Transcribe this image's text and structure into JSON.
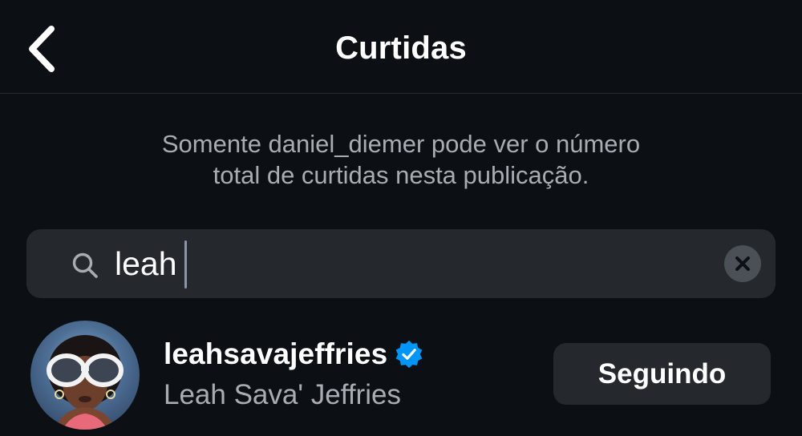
{
  "header": {
    "title": "Curtidas",
    "back_icon": "chevron-left-icon"
  },
  "info": {
    "line1": "Somente daniel_diemer pode ver o número",
    "line2": "total de curtidas nesta publicação."
  },
  "search": {
    "value": "leah",
    "icon": "search-icon",
    "clear_icon": "clear-icon"
  },
  "results": [
    {
      "username": "leahsavajeffries",
      "verified": true,
      "full_name": "Leah Sava' Jeffries",
      "button_label": "Seguindo"
    }
  ],
  "colors": {
    "background": "#0c1014",
    "field_background": "#25292e",
    "secondary_text": "#a8adb3",
    "verified_badge": "#0095f6"
  }
}
